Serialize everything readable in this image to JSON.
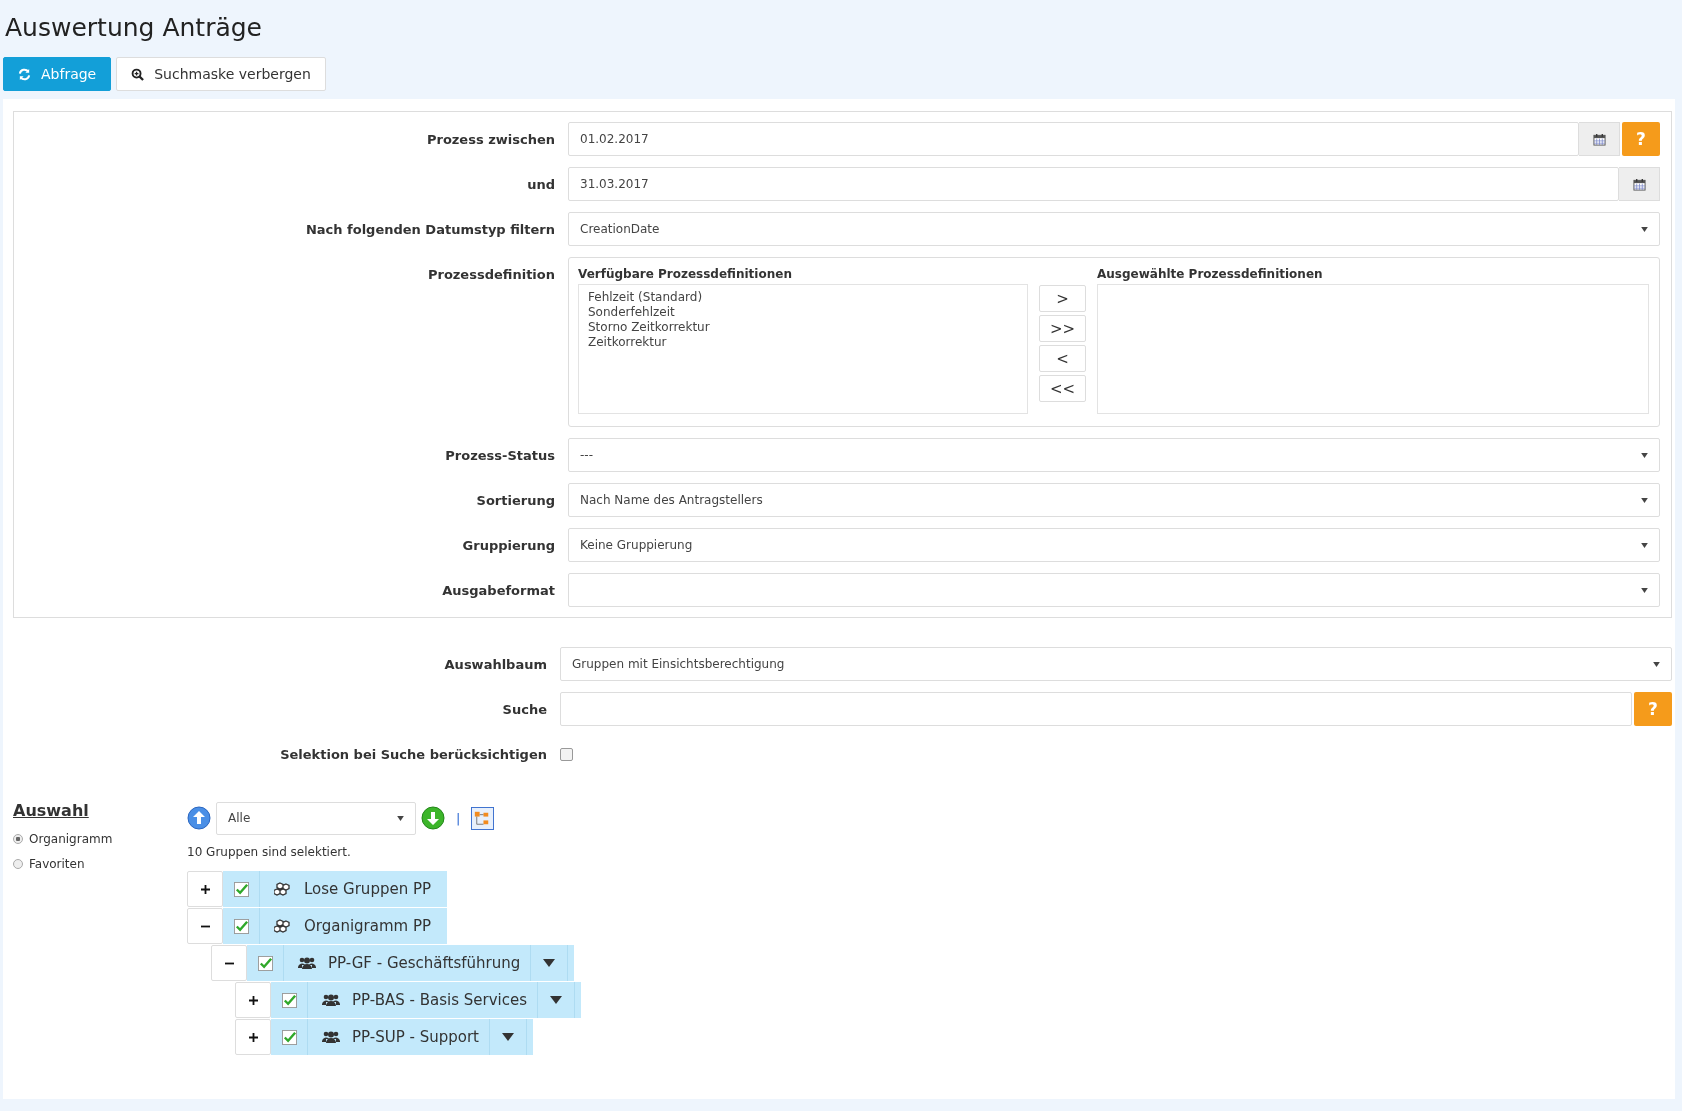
{
  "title": "Auswertung Anträge",
  "toolbar": [
    {
      "label": "Abfrage",
      "kind": "primary"
    },
    {
      "label": "Suchmaske verbergen",
      "kind": "default"
    }
  ],
  "filters": [
    {
      "kind": "date",
      "label": "Prozess zwischen",
      "value": "01.02.2017",
      "help": "?"
    },
    {
      "kind": "date",
      "label": "und",
      "value": "31.03.2017"
    },
    {
      "kind": "select",
      "label": "Nach folgenden Datumstyp filtern",
      "value": "CreationDate"
    },
    {
      "kind": "picklist",
      "label": "Prozessdefinition",
      "available_title": "Verfügbare Prozessdefinitionen",
      "available": [
        "Fehlzeit (Standard)",
        "Sonderfehlzeit",
        "Storno Zeitkorrektur",
        "Zeitkorrektur"
      ],
      "selected_title": "Ausgewählte Prozessdefinitionen",
      "move_buttons": [
        ">",
        ">>",
        "<",
        "<<"
      ]
    },
    {
      "kind": "select",
      "label": "Prozess-Status",
      "value": "---"
    },
    {
      "kind": "select",
      "label": "Sortierung",
      "value": "Nach Name des Antragstellers"
    },
    {
      "kind": "select",
      "label": "Gruppierung",
      "value": "Keine Gruppierung"
    },
    {
      "kind": "select",
      "label": "Ausgabeformat"
    }
  ],
  "tree_filters": [
    {
      "kind": "select",
      "label": "Auswahlbaum",
      "value": "Gruppen mit Einsichtsberechtigung"
    },
    {
      "kind": "search",
      "label": "Suche",
      "help": "?"
    },
    {
      "kind": "checkbox",
      "label": "Selektion bei Suche berücksichtigen",
      "checked": false
    }
  ],
  "auswahl": {
    "title": "Auswahl",
    "options": [
      {
        "label": "Organigramm",
        "selected": true
      },
      {
        "label": "Favoriten",
        "selected": false
      }
    ],
    "level_select": "Alle",
    "separator": "|",
    "status": "10 Gruppen sind selektiert.",
    "tree": [
      {
        "kind": "root",
        "label": "Lose Gruppen PP",
        "checked": true,
        "expanded": false
      },
      {
        "kind": "root",
        "label": "Organigramm PP",
        "checked": true,
        "expanded": true,
        "children": [
          {
            "kind": "unit",
            "label": "PP-GF - Geschäftsführung",
            "checked": true,
            "expanded": true,
            "children": [
              {
                "kind": "unit",
                "label": "PP-BAS - Basis Services",
                "checked": true,
                "expanded": false
              },
              {
                "kind": "unit",
                "label": "PP-SUP - Support",
                "checked": true,
                "expanded": false
              }
            ]
          }
        ]
      }
    ]
  }
}
